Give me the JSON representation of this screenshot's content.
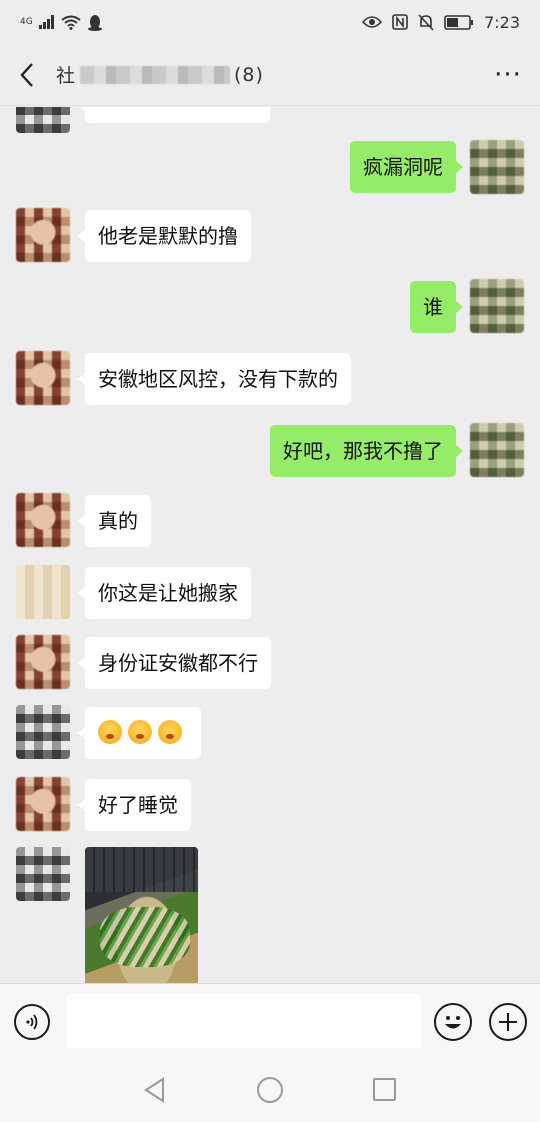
{
  "status_bar": {
    "network": "4G",
    "time": "7:23",
    "battery_icon": "battery-icon"
  },
  "header": {
    "title_prefix": "社",
    "title_suffix": "(8)",
    "back_icon": "chevron-left-icon",
    "more_label": "···"
  },
  "messages": [
    {
      "side": "left",
      "avatar": "av-gray",
      "text": "",
      "partial": true
    },
    {
      "side": "right",
      "avatar": "av-green",
      "text": "疯漏洞呢"
    },
    {
      "side": "left",
      "avatar": "av-girl",
      "text": "他老是默默的撸"
    },
    {
      "side": "right",
      "avatar": "av-green",
      "text": "谁"
    },
    {
      "side": "left",
      "avatar": "av-girl",
      "text": "安徽地区风控，没有下款的"
    },
    {
      "side": "right",
      "avatar": "av-green",
      "text": "好吧，那我不撸了"
    },
    {
      "side": "left",
      "avatar": "av-girl",
      "text": "真的"
    },
    {
      "side": "left",
      "avatar": "av-beige",
      "text": "你这是让她搬家"
    },
    {
      "side": "left",
      "avatar": "av-girl",
      "text": "身份证安徽都不行"
    },
    {
      "side": "left",
      "avatar": "av-gray",
      "emoji": [
        "shush-face",
        "shush-face",
        "shush-face"
      ]
    },
    {
      "side": "left",
      "avatar": "av-girl",
      "text": "好了睡觉"
    },
    {
      "side": "left",
      "avatar": "av-gray",
      "image": "food-photo"
    }
  ],
  "input_bar": {
    "placeholder": ""
  },
  "colors": {
    "background": "#ededed",
    "bubble_sent": "#95ec69",
    "bubble_received": "#ffffff"
  }
}
